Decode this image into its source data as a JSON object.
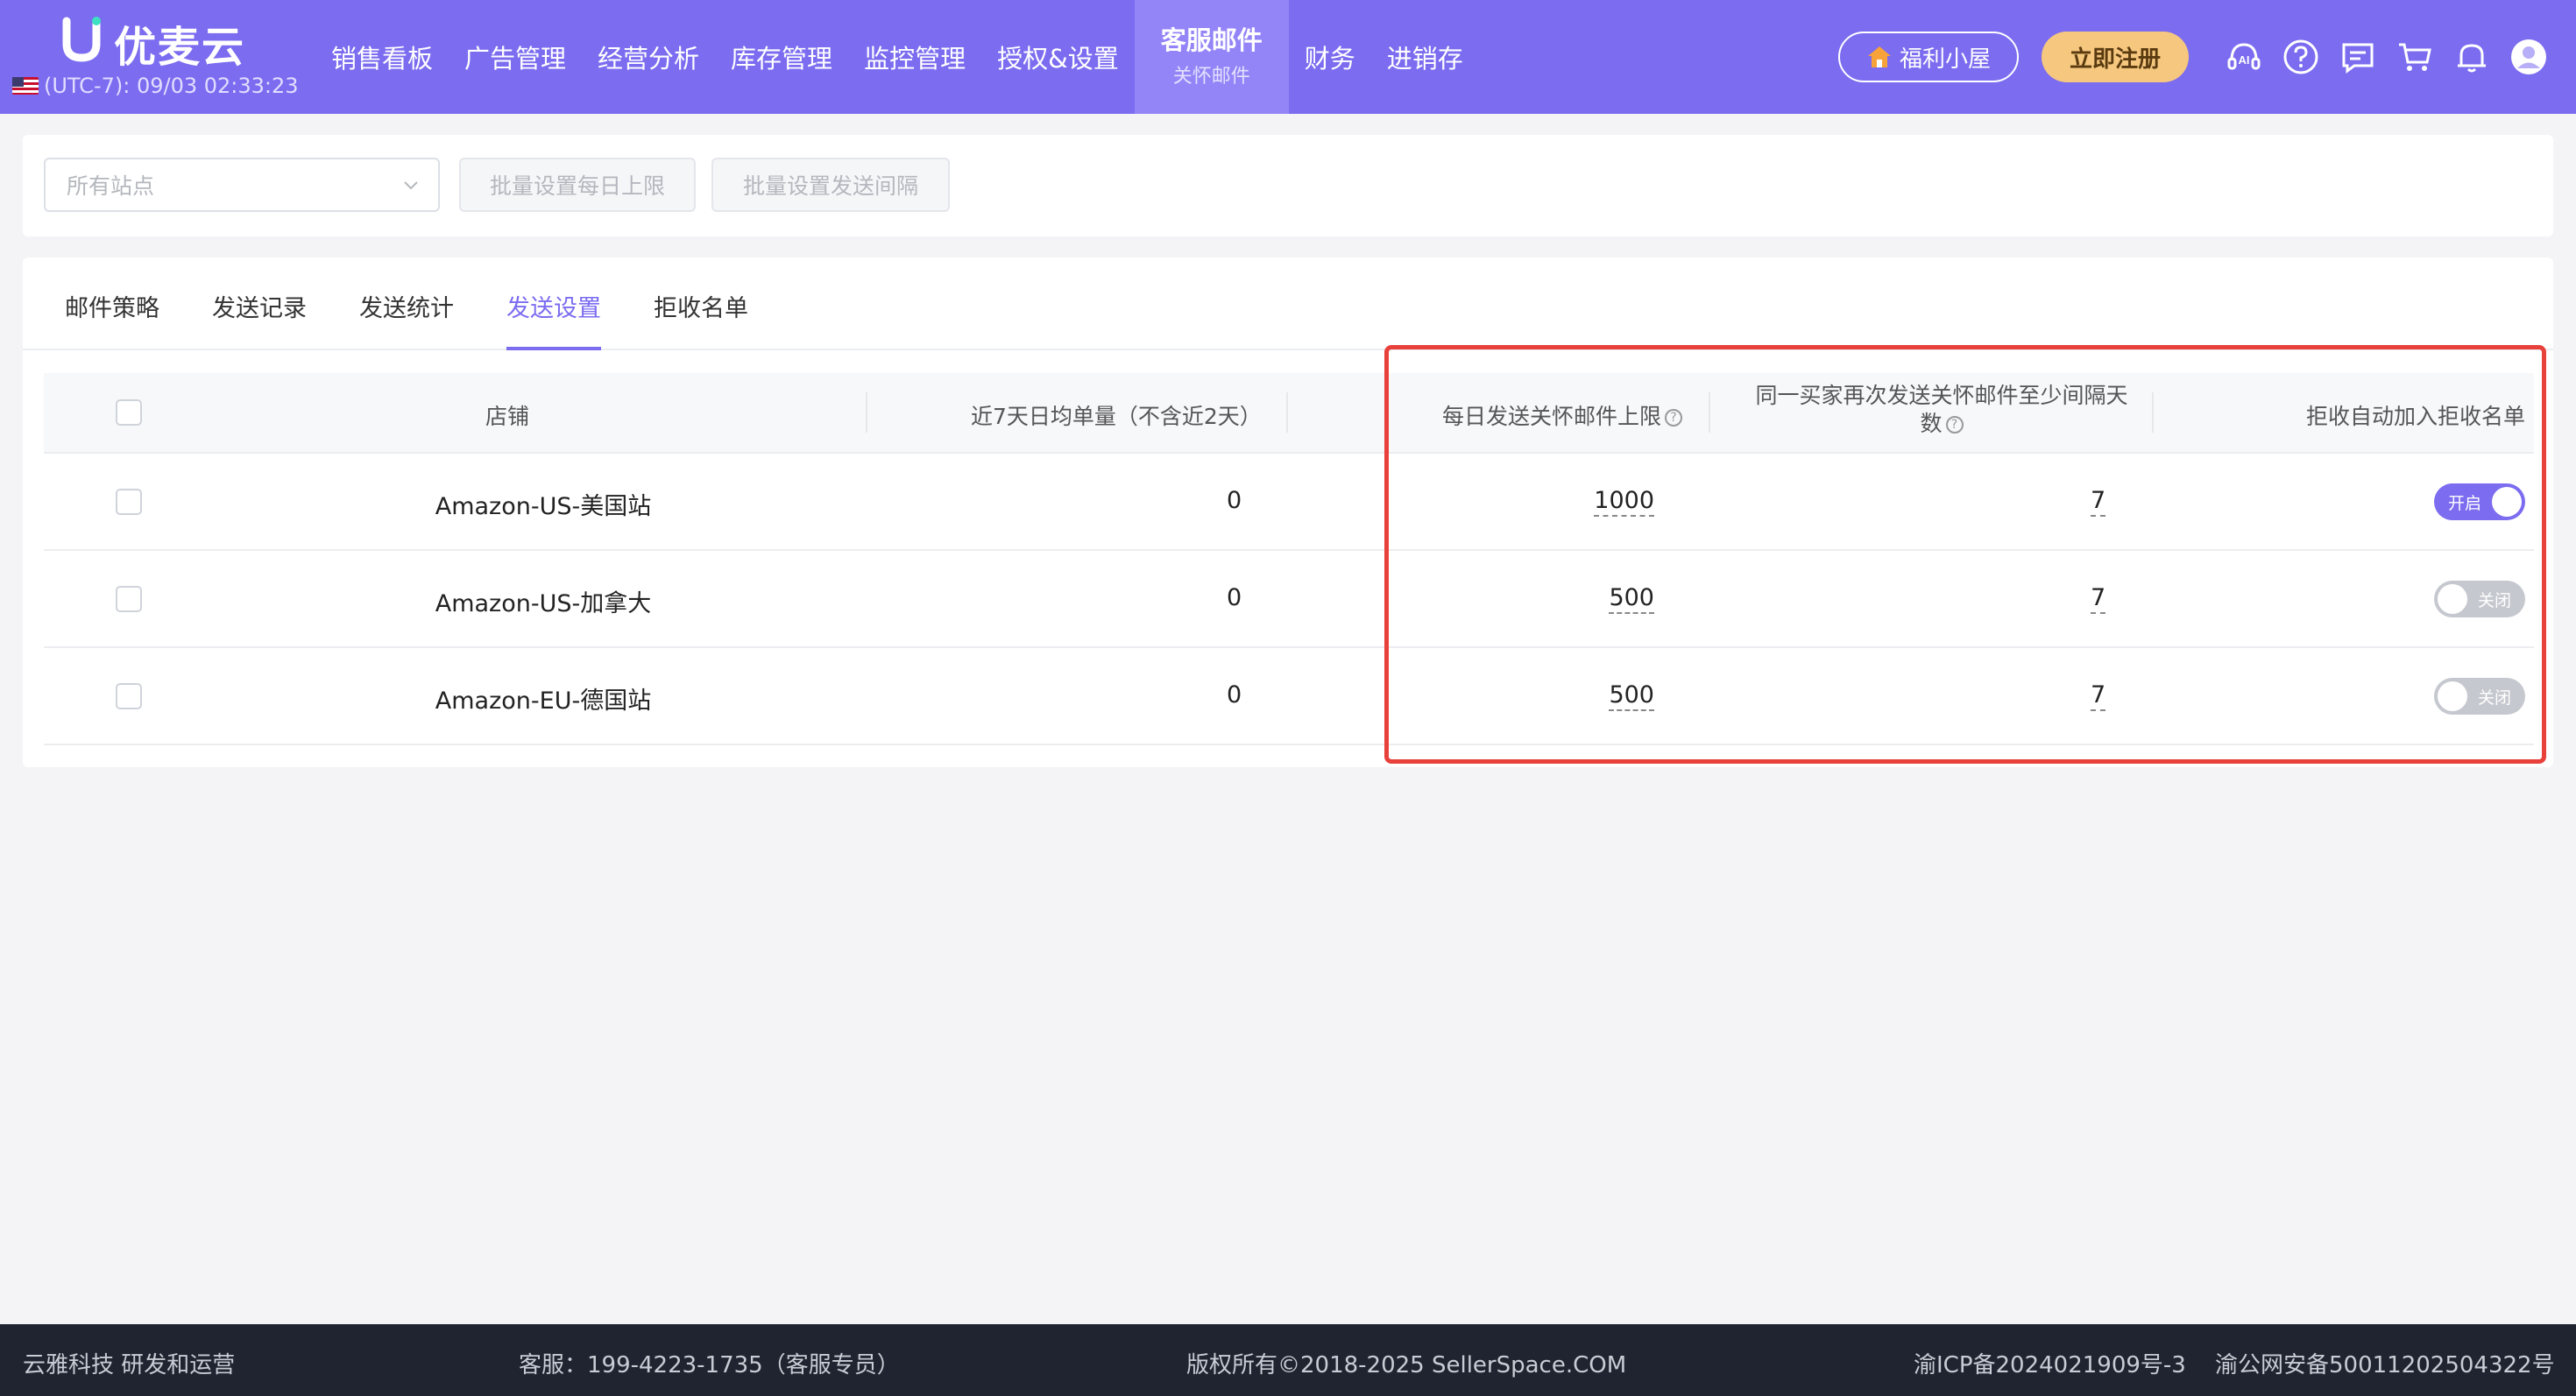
{
  "colors": {
    "accent": "#7b6cf0",
    "highlight": "#e8403a",
    "register": "#f6c77f",
    "footer": "#1f2430"
  },
  "brand": {
    "name": "优麦云",
    "timezone": "(UTC-7): 09/03 02:33:23"
  },
  "menu": [
    {
      "label": "销售看板"
    },
    {
      "label": "广告管理"
    },
    {
      "label": "经营分析"
    },
    {
      "label": "库存管理"
    },
    {
      "label": "监控管理"
    },
    {
      "label": "授权&设置"
    },
    {
      "label": "客服邮件",
      "sub": "关怀邮件",
      "active": true
    },
    {
      "label": "财务"
    },
    {
      "label": "进销存"
    }
  ],
  "header_right": {
    "welfare_label": "福利小屋",
    "register_label": "立即注册",
    "icons": [
      "ai-assistant-icon",
      "help-icon",
      "message-icon",
      "cart-icon",
      "bell-icon",
      "avatar-icon"
    ]
  },
  "filters": {
    "site_select_placeholder": "所有站点",
    "batch_daily_limit": "批量设置每日上限",
    "batch_interval": "批量设置发送间隔"
  },
  "tabs": [
    {
      "label": "邮件策略"
    },
    {
      "label": "发送记录"
    },
    {
      "label": "发送统计"
    },
    {
      "label": "发送设置",
      "active": true
    },
    {
      "label": "拒收名单"
    }
  ],
  "table": {
    "headers": {
      "store": "店铺",
      "avg_orders": "近7天日均单量（不含近2天）",
      "daily_limit": "每日发送关怀邮件上限",
      "interval_line1": "同一买家再次发送关怀邮件至少间隔天",
      "interval_line2": "数",
      "auto_reject": "拒收自动加入拒收名单"
    },
    "rows": [
      {
        "store": "Amazon-US-美国站",
        "avg_orders": "0",
        "daily_limit": "1000",
        "interval": "7",
        "toggle_on": true,
        "toggle_label": "开启"
      },
      {
        "store": "Amazon-US-加拿大",
        "avg_orders": "0",
        "daily_limit": "500",
        "interval": "7",
        "toggle_on": false,
        "toggle_label": "关闭"
      },
      {
        "store": "Amazon-EU-德国站",
        "avg_orders": "0",
        "daily_limit": "500",
        "interval": "7",
        "toggle_on": false,
        "toggle_label": "关闭"
      }
    ]
  },
  "footer": {
    "company": "云雅科技 研发和运营",
    "support": "客服：199-4223-1735（客服专员）",
    "copyright": "版权所有©2018-2025 SellerSpace.COM",
    "icp": "渝ICP备2024021909号-3",
    "police": "渝公网安备50011202504322号"
  }
}
